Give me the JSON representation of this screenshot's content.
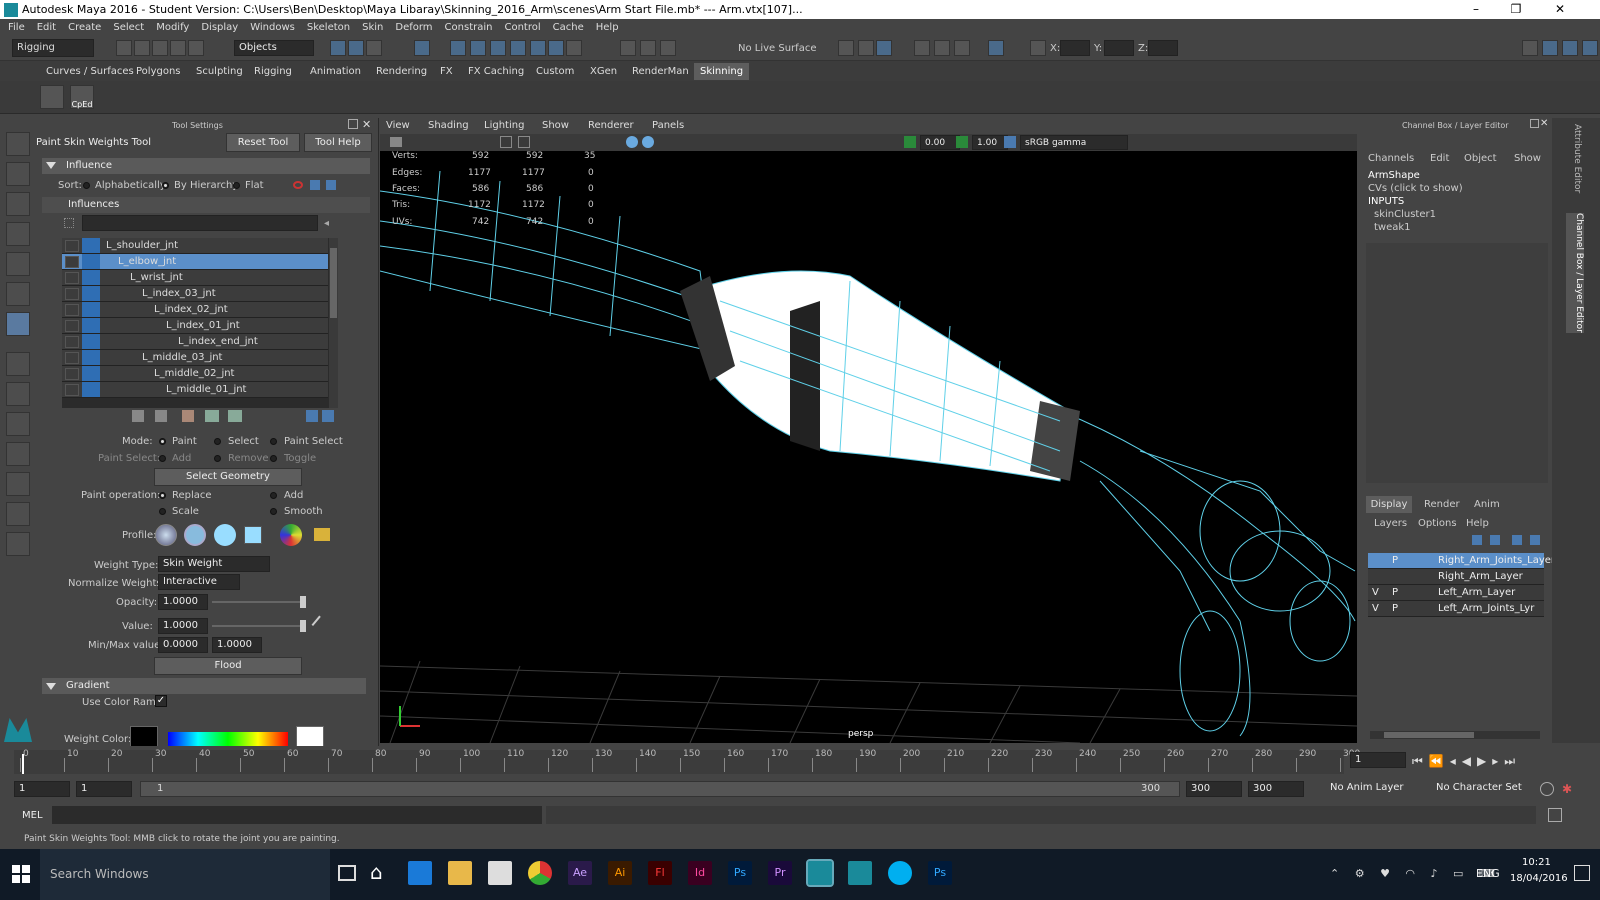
{
  "window": {
    "title": "Autodesk Maya 2016 - Student Version: C:\\Users\\Ben\\Desktop\\Maya Libaray\\Skinning_2016_Arm\\scenes\\Arm Start File.mb*  ---  Arm.vtx[107]...",
    "minimize": "–",
    "maximize": "❐",
    "close": "✕"
  },
  "menu": [
    "File",
    "Edit",
    "Create",
    "Select",
    "Modify",
    "Display",
    "Windows",
    "Skeleton",
    "Skin",
    "Deform",
    "Constrain",
    "Control",
    "Cache",
    "Help"
  ],
  "status": {
    "mode": "Rigging",
    "objects": "Objects",
    "live_surface": "No Live Surface",
    "x": "X:",
    "y": "Y:",
    "z": "Z:"
  },
  "shelf_tabs": [
    "Curves / Surfaces",
    "Polygons",
    "Sculpting",
    "Rigging",
    "Animation",
    "Rendering",
    "FX",
    "FX Caching",
    "Custom",
    "XGen",
    "RenderMan",
    "Skinning"
  ],
  "shelf_active": "Skinning",
  "shelf_items": {
    "cped": "CpEd"
  },
  "tool_settings": {
    "panel_title": "Tool Settings",
    "tool_name": "Paint Skin Weights Tool",
    "reset": "Reset Tool",
    "help": "Tool Help",
    "influence_header": "Influence",
    "sort_label": "Sort:",
    "sort_alpha": "Alphabetically",
    "sort_hier": "By Hierarchy",
    "sort_flat": "Flat",
    "influences_header": "Influences",
    "influences": [
      {
        "name": "L_shoulder_jnt",
        "indent": 0
      },
      {
        "name": "L_elbow_jnt",
        "indent": 1,
        "selected": true
      },
      {
        "name": "L_wrist_jnt",
        "indent": 2
      },
      {
        "name": "L_index_03_jnt",
        "indent": 3
      },
      {
        "name": "L_index_02_jnt",
        "indent": 4
      },
      {
        "name": "L_index_01_jnt",
        "indent": 5
      },
      {
        "name": "L_index_end_jnt",
        "indent": 6
      },
      {
        "name": "L_middle_03_jnt",
        "indent": 3
      },
      {
        "name": "L_middle_02_jnt",
        "indent": 4
      },
      {
        "name": "L_middle_01_jnt",
        "indent": 5
      }
    ],
    "mode_label": "Mode:",
    "mode_paint": "Paint",
    "mode_select": "Select",
    "mode_paint_select": "Paint Select",
    "paint_select_label": "Paint Select:",
    "ps_add": "Add",
    "ps_remove": "Remove",
    "ps_toggle": "Toggle",
    "select_geometry": "Select Geometry",
    "paint_op_label": "Paint operation:",
    "op_replace": "Replace",
    "op_add": "Add",
    "op_scale": "Scale",
    "op_smooth": "Smooth",
    "profile_label": "Profile:",
    "weight_type_label": "Weight Type:",
    "weight_type": "Skin Weight",
    "normalize_label": "Normalize Weights:",
    "normalize": "Interactive",
    "opacity_label": "Opacity:",
    "opacity": "1.0000",
    "opacity_level": 1.0,
    "value_label": "Value:",
    "value": "1.0000",
    "value_level": 1.0,
    "minmax_label": "Min/Max value:",
    "min": "0.0000",
    "max": "1.0000",
    "flood": "Flood",
    "gradient_header": "Gradient",
    "use_color_ramp": "Use Color Ramp",
    "weight_color_label": "Weight Color:"
  },
  "viewport": {
    "menu": [
      "View",
      "Shading",
      "Lighting",
      "Show",
      "Renderer",
      "Panels"
    ],
    "exposure": "0.00",
    "gamma": "1.00",
    "colorspace": "sRGB gamma",
    "camera": "persp",
    "hud": [
      {
        "label": "Verts:",
        "a": "592",
        "b": "592",
        "c": "35"
      },
      {
        "label": "Edges:",
        "a": "1177",
        "b": "1177",
        "c": "0"
      },
      {
        "label": "Faces:",
        "a": "586",
        "b": "586",
        "c": "0"
      },
      {
        "label": "Tris:",
        "a": "1172",
        "b": "1172",
        "c": "0"
      },
      {
        "label": "UVs:",
        "a": "742",
        "b": "742",
        "c": "0"
      }
    ]
  },
  "channel_box": {
    "title": "Channel Box / Layer Editor",
    "menu": [
      "Channels",
      "Edit",
      "Object",
      "Show"
    ],
    "object": "ArmShape",
    "cvs": "CVs (click to show)",
    "inputs_label": "INPUTS",
    "inputs": [
      "skinCluster1",
      "tweak1"
    ]
  },
  "layer_editor": {
    "tabs": [
      "Display",
      "Render",
      "Anim"
    ],
    "active_tab": "Display",
    "menu": [
      "Layers",
      "Options",
      "Help"
    ],
    "layers": [
      {
        "v": "",
        "p": "P",
        "name": "Right_Arm_Joints_Layer",
        "selected": true
      },
      {
        "v": "",
        "p": "",
        "name": "Right_Arm_Layer"
      },
      {
        "v": "V",
        "p": "P",
        "name": "Left_Arm_Layer"
      },
      {
        "v": "V",
        "p": "P",
        "name": "Left_Arm_Joints_Lyr"
      }
    ]
  },
  "side_tabs": [
    "Attribute Editor",
    "Channel Box / Layer Editor"
  ],
  "timeline": {
    "ticks": [
      "0",
      "10",
      "20",
      "30",
      "40",
      "50",
      "60",
      "70",
      "80",
      "90",
      "100",
      "110",
      "120",
      "130",
      "140",
      "150",
      "160",
      "170",
      "180",
      "190",
      "200",
      "210",
      "220",
      "230",
      "240",
      "250",
      "260",
      "270",
      "280",
      "290",
      "300"
    ],
    "current_frame": "1"
  },
  "range": {
    "start": "1",
    "anim_start": "1",
    "range_start": "1",
    "range_end": "300",
    "anim_end": "300",
    "end": "300",
    "anim_layer": "No Anim Layer",
    "char_set": "No Character Set"
  },
  "cmd": {
    "lang": "MEL"
  },
  "help_line": "Paint Skin Weights Tool: MMB click to rotate the joint you are painting.",
  "taskbar": {
    "search": "Search Windows",
    "lang": "ENG",
    "time": "10:21",
    "date": "18/04/2016",
    "apps": [
      "Ae",
      "Ai",
      "Fl",
      "Id",
      "Ps",
      "Pr",
      "Ps"
    ]
  },
  "colors": {
    "accent": "#5b8fc9",
    "viewport_bg": "#000000",
    "wire": "#5fd0e8",
    "taskbar": "#101a26"
  }
}
